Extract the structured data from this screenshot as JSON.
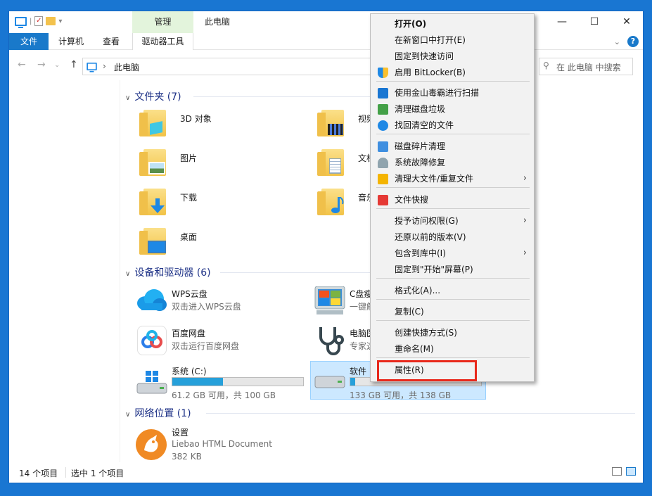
{
  "window": {
    "title": "此电脑",
    "context_tab": "管理",
    "controls": [
      "—",
      "☐",
      "✕"
    ]
  },
  "ribbon": {
    "tabs": [
      "文件",
      "计算机",
      "查看",
      "驱动器工具"
    ],
    "help": "?"
  },
  "address": {
    "path": "此电脑",
    "search_placeholder": "在 此电脑 中搜索"
  },
  "groups": {
    "folders": "文件夹 (7)",
    "devices": "设备和驱动器 (6)",
    "network": "网络位置 (1)"
  },
  "folders": [
    {
      "name": "3D 对象"
    },
    {
      "name": "视频"
    },
    {
      "name": "图片"
    },
    {
      "name": "文档"
    },
    {
      "name": "下载"
    },
    {
      "name": "音乐"
    },
    {
      "name": "桌面"
    }
  ],
  "devices": [
    {
      "name": "WPS云盘",
      "sub": "双击进入WPS云盘"
    },
    {
      "name": "C盘瘦",
      "sub": "一键解"
    },
    {
      "name": "百度网盘",
      "sub": "双击运行百度网盘"
    },
    {
      "name": "电脑医",
      "sub": "专家这"
    },
    {
      "name": "系统 (C:)",
      "sub": "61.2 GB 可用，共 100 GB",
      "usage": 0.388
    },
    {
      "name": "软件",
      "sub": "133 GB 可用，共 138 GB",
      "usage": 0.036
    }
  ],
  "network": [
    {
      "name": "设置",
      "sub": "Liebao HTML Document",
      "size": "382 KB"
    }
  ],
  "status": {
    "count": "14 个项目",
    "selected": "选中 1 个项目"
  },
  "context_menu": [
    {
      "label": "打开(O)",
      "bold": true,
      "icon": "none"
    },
    {
      "label": "在新窗口中打开(E)",
      "icon": "none"
    },
    {
      "label": "固定到快速访问",
      "icon": "none"
    },
    {
      "label": "启用 BitLocker(B)",
      "icon": "shield-icon"
    },
    {
      "label": "使用金山毒霸进行扫描",
      "icon": "duba-icon"
    },
    {
      "label": "清理磁盘垃圾",
      "icon": "cleanup-icon"
    },
    {
      "label": "找回清空的文件",
      "icon": "recover-icon"
    },
    {
      "label": "磁盘碎片清理",
      "icon": "defrag-icon"
    },
    {
      "label": "系统故障修复",
      "icon": "wrench-icon"
    },
    {
      "label": "清理大文件/重复文件",
      "icon": "bigfile-icon",
      "submenu": true
    },
    {
      "label": "文件快搜",
      "icon": "wps-icon"
    },
    {
      "label": "授予访问权限(G)",
      "icon": "none",
      "submenu": true
    },
    {
      "label": "还原以前的版本(V)",
      "icon": "none"
    },
    {
      "label": "包含到库中(I)",
      "icon": "none",
      "submenu": true
    },
    {
      "label": "固定到\"开始\"屏幕(P)",
      "icon": "none"
    },
    {
      "label": "格式化(A)...",
      "icon": "none"
    },
    {
      "label": "复制(C)",
      "icon": "none"
    },
    {
      "label": "创建快捷方式(S)",
      "icon": "none"
    },
    {
      "label": "重命名(M)",
      "icon": "none"
    },
    {
      "label": "属性(R)",
      "icon": "none"
    }
  ],
  "colors": {
    "accent": "#1979ca",
    "drive_bar": "#26a0da",
    "highlight_box": "#e8281b",
    "selection": "#cce8ff"
  }
}
